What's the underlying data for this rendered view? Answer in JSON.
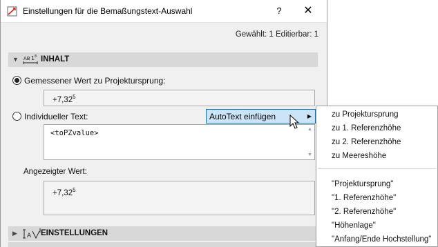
{
  "window": {
    "title": "Einstellungen für die Bemaßungstext-Auswahl",
    "help_label": "?",
    "close_label": "✕"
  },
  "status_text": "Gewählt: 1 Editierbar: 1",
  "sections": {
    "inhalt": {
      "label": "INHALT",
      "toggle": "▼",
      "icon": "dimension-text-icon"
    },
    "einstellungen": {
      "label": "EINSTELLUNGEN",
      "toggle": "▶",
      "icon": "text-settings-icon"
    }
  },
  "options": {
    "measured": {
      "label": "Gemessener Wert zu Projektursprung:",
      "selected": true,
      "value": "+7,32",
      "value_sup": "5"
    },
    "custom": {
      "label": "Individueller Text:",
      "selected": false,
      "text": "<toPZvalue>"
    }
  },
  "displayed": {
    "label": "Angezeigter Wert:",
    "value": "+7,32",
    "value_sup": "5"
  },
  "autotext": {
    "label": "AutoText einfügen",
    "arrow": "▶"
  },
  "menu": {
    "items_top": [
      "zu Projektursprung",
      "zu 1. Referenzhöhe",
      "zu 2. Referenzhöhe",
      "zu Meereshöhe"
    ],
    "items_bottom": [
      "\"Projektursprung\"",
      "\"1. Referenzhöhe\"",
      "\"2. Referenzhöhe\"",
      "\"Höhenlage\"",
      "\"Anfang/Ende Hochstellung\""
    ]
  },
  "colors": {
    "accent": "#0078d7",
    "highlight": "#cce4f7",
    "section_bg": "#d8d8d8",
    "dialog_bg": "#f0f0f0"
  }
}
